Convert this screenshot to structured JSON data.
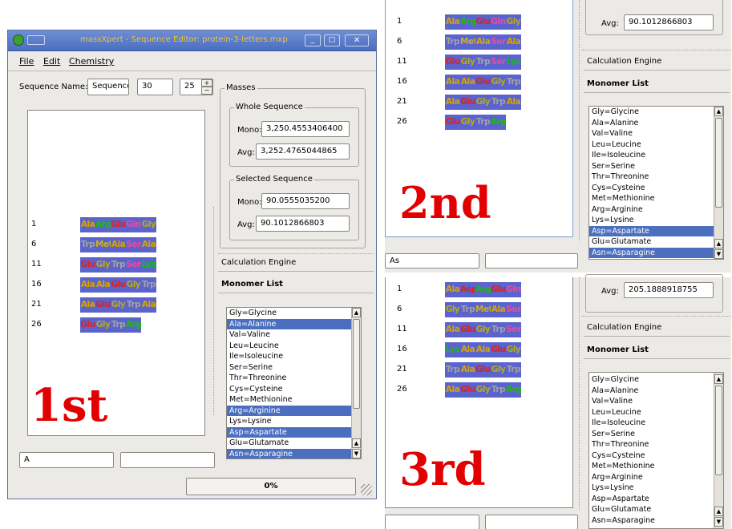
{
  "colors": {
    "ala": "#d9a400",
    "arg": "#18c000",
    "glu": "#e02020",
    "gln": "#ea4aa4",
    "gly": "#b6ac1a",
    "trp": "#a2a2a2",
    "met": "#cab020",
    "ser": "#ea4aa4",
    "lys": "#10c010",
    "asp": "#e02020",
    "cellbg": "#5b63cc",
    "listsel": "#4b6ebf",
    "annotation": "#e30000",
    "titlebar": "#4b6ebf"
  },
  "window1": {
    "title": "massXpert - Sequence Editor: protein-3-letters.mxp",
    "menu": [
      "File",
      "Edit",
      "Chemistry"
    ],
    "sequence_name_label": "Sequence Name:",
    "sequence_name_value": "Sequence",
    "spin_a": "30",
    "spin_b": "25",
    "masses_group": "Masses",
    "whole_group": "Whole Sequence",
    "whole_mono_label": "Mono:",
    "whole_mono": "3,250.4553406400",
    "whole_avg_label": "Avg:",
    "whole_avg": "3,252.4765044865",
    "selected_group": "Selected Sequence",
    "sel_mono_label": "Mono:",
    "sel_mono": "90.0555035200",
    "sel_avg_label": "Avg:",
    "sel_avg": "90.1012866803",
    "calc_engine": "Calculation Engine",
    "monomer_list": "Monomer List",
    "row_numbers": [
      "1",
      "6",
      "11",
      "16",
      "21",
      "26"
    ],
    "rows": [
      [
        {
          "t": "Ala",
          "c": "ala"
        },
        {
          "t": "Arg",
          "c": "arg"
        },
        {
          "t": "Glu",
          "c": "glu"
        },
        {
          "t": "Gln",
          "c": "gln"
        },
        {
          "t": "Gly",
          "c": "gly"
        }
      ],
      [
        {
          "t": "Trp",
          "c": "trp"
        },
        {
          "t": "Met",
          "c": "met"
        },
        {
          "t": "Ala",
          "c": "ala"
        },
        {
          "t": "Ser",
          "c": "ser"
        },
        {
          "t": "Ala",
          "c": "ala"
        }
      ],
      [
        {
          "t": "Glu",
          "c": "glu"
        },
        {
          "t": "Gly",
          "c": "gly"
        },
        {
          "t": "Trp",
          "c": "trp"
        },
        {
          "t": "Ser",
          "c": "ser"
        },
        {
          "t": "Lys",
          "c": "lys"
        }
      ],
      [
        {
          "t": "Ala",
          "c": "ala"
        },
        {
          "t": "Ala",
          "c": "ala"
        },
        {
          "t": "Glu",
          "c": "glu"
        },
        {
          "t": "Gly",
          "c": "gly"
        },
        {
          "t": "Trp",
          "c": "trp"
        }
      ],
      [
        {
          "t": "Ala",
          "c": "ala"
        },
        {
          "t": "Glu",
          "c": "glu"
        },
        {
          "t": "Gly",
          "c": "gly"
        },
        {
          "t": "Trp",
          "c": "trp"
        },
        {
          "t": "Ala",
          "c": "ala"
        }
      ],
      [
        {
          "t": "Glu",
          "c": "glu"
        },
        {
          "t": "Gly",
          "c": "gly"
        },
        {
          "t": "Trp",
          "c": "trp"
        },
        {
          "t": "Arg",
          "c": "arg"
        }
      ]
    ],
    "monomers": [
      "Gly=Glycine",
      "Ala=Alanine",
      "Val=Valine",
      "Leu=Leucine",
      "Ile=Isoleucine",
      "Ser=Serine",
      "Thr=Threonine",
      "Cys=Cysteine",
      "Met=Methionine",
      "Arg=Arginine",
      "Lys=Lysine",
      "Asp=Aspartate",
      "Glu=Glutamate",
      "Asn=Asparagine"
    ],
    "selected_monomers": [
      1,
      9,
      11,
      13
    ],
    "filter_input": "A",
    "progress": "0%",
    "progress_value": 0,
    "annotation": "1st"
  },
  "window2": {
    "row_numbers": [
      "1",
      "6",
      "11",
      "16",
      "21",
      "26"
    ],
    "rows": [
      [
        {
          "t": "Ala",
          "c": "ala"
        },
        {
          "t": "Arg",
          "c": "arg"
        },
        {
          "t": "Glu",
          "c": "glu"
        },
        {
          "t": "Gln",
          "c": "gln"
        },
        {
          "t": "Gly",
          "c": "gly"
        }
      ],
      [
        {
          "t": "Trp",
          "c": "trp"
        },
        {
          "t": "Met",
          "c": "met"
        },
        {
          "t": "Ala",
          "c": "ala"
        },
        {
          "t": "Ser",
          "c": "ser"
        },
        {
          "t": "Ala",
          "c": "ala"
        }
      ],
      [
        {
          "t": "Glu",
          "c": "glu"
        },
        {
          "t": "Gly",
          "c": "gly"
        },
        {
          "t": "Trp",
          "c": "trp"
        },
        {
          "t": "Ser",
          "c": "ser"
        },
        {
          "t": "Lys",
          "c": "lys"
        }
      ],
      [
        {
          "t": "Ala",
          "c": "ala"
        },
        {
          "t": "Ala",
          "c": "ala"
        },
        {
          "t": "Glu",
          "c": "glu"
        },
        {
          "t": "Gly",
          "c": "gly"
        },
        {
          "t": "Trp",
          "c": "trp"
        }
      ],
      [
        {
          "t": "Ala",
          "c": "ala"
        },
        {
          "t": "Glu",
          "c": "glu"
        },
        {
          "t": "Gly",
          "c": "gly"
        },
        {
          "t": "Trp",
          "c": "trp"
        },
        {
          "t": "Ala",
          "c": "ala"
        }
      ],
      [
        {
          "t": "Glu",
          "c": "glu"
        },
        {
          "t": "Gly",
          "c": "gly"
        },
        {
          "t": "Trp",
          "c": "trp"
        },
        {
          "t": "Arg",
          "c": "arg"
        }
      ]
    ],
    "avg_label": "Avg:",
    "avg": "90.1012866803",
    "calc_engine": "Calculation Engine",
    "monomer_list": "Monomer List",
    "monomers": [
      "Gly=Glycine",
      "Ala=Alanine",
      "Val=Valine",
      "Leu=Leucine",
      "Ile=Isoleucine",
      "Ser=Serine",
      "Thr=Threonine",
      "Cys=Cysteine",
      "Met=Methionine",
      "Arg=Arginine",
      "Lys=Lysine",
      "Asp=Aspartate",
      "Glu=Glutamate",
      "Asn=Asparagine"
    ],
    "selected_monomers": [
      11,
      13
    ],
    "filter_input": "As",
    "annotation": "2nd"
  },
  "window3": {
    "row_numbers": [
      "1",
      "6",
      "11",
      "16",
      "21",
      "26"
    ],
    "rows": [
      [
        {
          "t": "Ala",
          "c": "ala"
        },
        {
          "t": "Asp",
          "c": "asp"
        },
        {
          "t": "Arg",
          "c": "arg"
        },
        {
          "t": "Glu",
          "c": "glu"
        },
        {
          "t": "Gln",
          "c": "gln"
        }
      ],
      [
        {
          "t": "Gly",
          "c": "gly"
        },
        {
          "t": "Trp",
          "c": "trp"
        },
        {
          "t": "Met",
          "c": "met"
        },
        {
          "t": "Ala",
          "c": "ala"
        },
        {
          "t": "Ser",
          "c": "ser"
        }
      ],
      [
        {
          "t": "Ala",
          "c": "ala"
        },
        {
          "t": "Glu",
          "c": "glu"
        },
        {
          "t": "Gly",
          "c": "gly"
        },
        {
          "t": "Trp",
          "c": "trp"
        },
        {
          "t": "Ser",
          "c": "ser"
        }
      ],
      [
        {
          "t": "Lys",
          "c": "lys"
        },
        {
          "t": "Ala",
          "c": "ala"
        },
        {
          "t": "Ala",
          "c": "ala"
        },
        {
          "t": "Glu",
          "c": "glu"
        },
        {
          "t": "Gly",
          "c": "gly"
        }
      ],
      [
        {
          "t": "Trp",
          "c": "trp"
        },
        {
          "t": "Ala",
          "c": "ala"
        },
        {
          "t": "Glu",
          "c": "glu"
        },
        {
          "t": "Gly",
          "c": "gly"
        },
        {
          "t": "Trp",
          "c": "trp"
        }
      ],
      [
        {
          "t": "Ala",
          "c": "ala"
        },
        {
          "t": "Glu",
          "c": "glu"
        },
        {
          "t": "Gly",
          "c": "gly"
        },
        {
          "t": "Trp",
          "c": "trp"
        },
        {
          "t": "Arg",
          "c": "arg"
        }
      ]
    ],
    "avg_label": "Avg:",
    "avg": "205.1888918755",
    "calc_engine": "Calculation Engine",
    "monomer_list": "Monomer List",
    "monomers": [
      "Gly=Glycine",
      "Ala=Alanine",
      "Val=Valine",
      "Leu=Leucine",
      "Ile=Isoleucine",
      "Ser=Serine",
      "Thr=Threonine",
      "Cys=Cysteine",
      "Met=Methionine",
      "Arg=Arginine",
      "Lys=Lysine",
      "Asp=Aspartate",
      "Glu=Glutamate",
      "Asn=Asparagine"
    ],
    "selected_monomers": [],
    "annotation": "3rd"
  }
}
